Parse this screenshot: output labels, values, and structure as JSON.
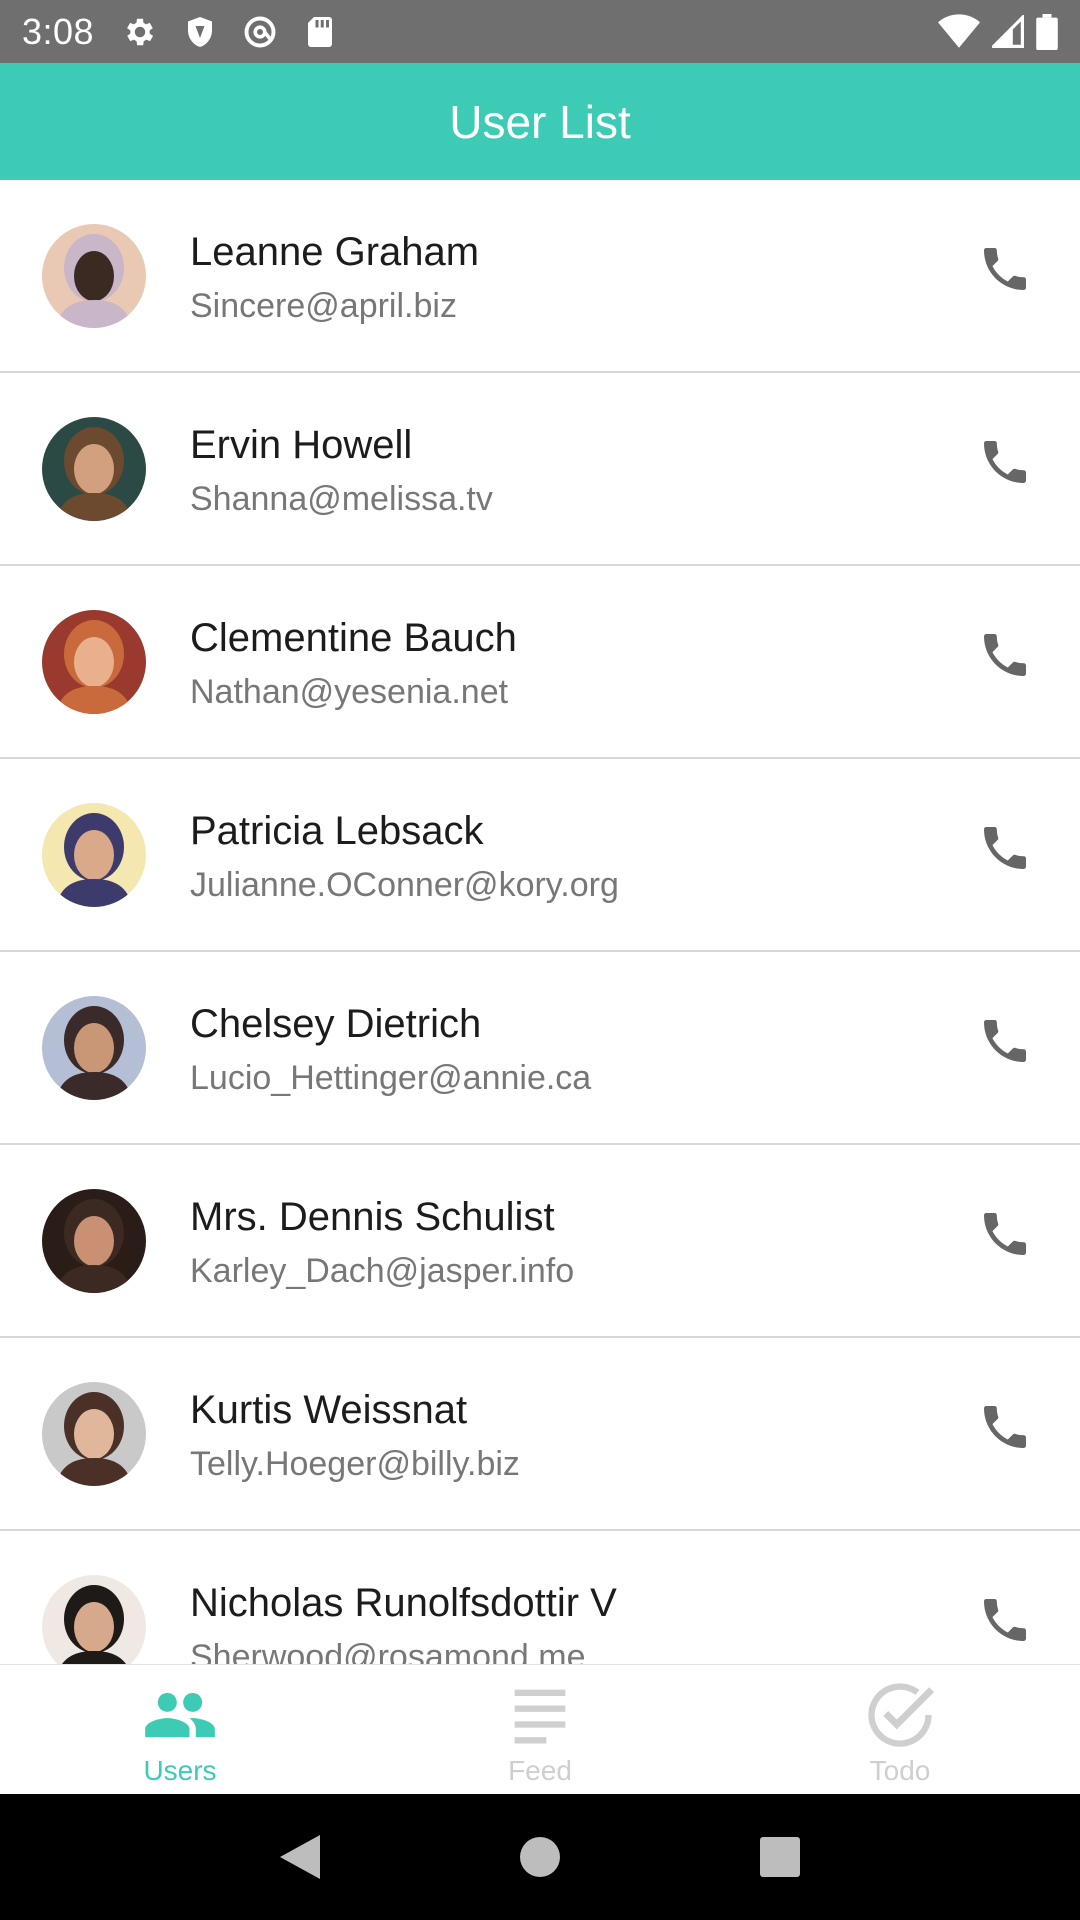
{
  "status_bar": {
    "time": "3:08",
    "left_icons": [
      "gear-icon",
      "shield-icon",
      "at-sign-icon",
      "sd-card-icon"
    ],
    "right_icons": [
      "wifi-icon",
      "signal-icon",
      "battery-icon"
    ],
    "background": "#6f6f6f"
  },
  "app_bar": {
    "title": "User List",
    "color": "#3dcbb6"
  },
  "users": [
    {
      "name": "Leanne Graham",
      "email": "Sincere@april.biz",
      "avatar_colors": [
        "#e9c9b3",
        "#3a2a22",
        "#c9b6c8"
      ]
    },
    {
      "name": "Ervin Howell",
      "email": "Shanna@melissa.tv",
      "avatar_colors": [
        "#2c4a45",
        "#d2a07e",
        "#6b4a2f"
      ]
    },
    {
      "name": "Clementine Bauch",
      "email": "Nathan@yesenia.net",
      "avatar_colors": [
        "#9a3a2e",
        "#e8b08c",
        "#c96a3c"
      ]
    },
    {
      "name": "Patricia Lebsack",
      "email": "Julianne.OConner@kory.org",
      "avatar_colors": [
        "#f5e7b0",
        "#d9a98a",
        "#3d3b6b"
      ]
    },
    {
      "name": "Chelsey Dietrich",
      "email": "Lucio_Hettinger@annie.ca",
      "avatar_colors": [
        "#b4bfd6",
        "#c99676",
        "#3a2b2a"
      ]
    },
    {
      "name": "Mrs. Dennis Schulist",
      "email": "Karley_Dach@jasper.info",
      "avatar_colors": [
        "#2a1d18",
        "#c99073",
        "#3c2a22"
      ]
    },
    {
      "name": "Kurtis Weissnat",
      "email": "Telly.Hoeger@billy.biz",
      "avatar_colors": [
        "#c9c9c9",
        "#e1b79b",
        "#4a3027"
      ]
    },
    {
      "name": "Nicholas Runolfsdottir V",
      "email": "Sherwood@rosamond.me",
      "avatar_colors": [
        "#efe8e3",
        "#d6a98d",
        "#1e1a18"
      ]
    }
  ],
  "bottom_nav": {
    "items": [
      {
        "label": "Users",
        "icon": "people-icon",
        "active": true
      },
      {
        "label": "Feed",
        "icon": "list-lines-icon",
        "active": false
      },
      {
        "label": "Todo",
        "icon": "check-circle-icon",
        "active": false
      }
    ],
    "active_color": "#3dcbb6",
    "inactive_color": "#cfcfcf"
  },
  "system_nav": {
    "icons": [
      "back-triangle-icon",
      "home-circle-icon",
      "recents-square-icon"
    ]
  }
}
